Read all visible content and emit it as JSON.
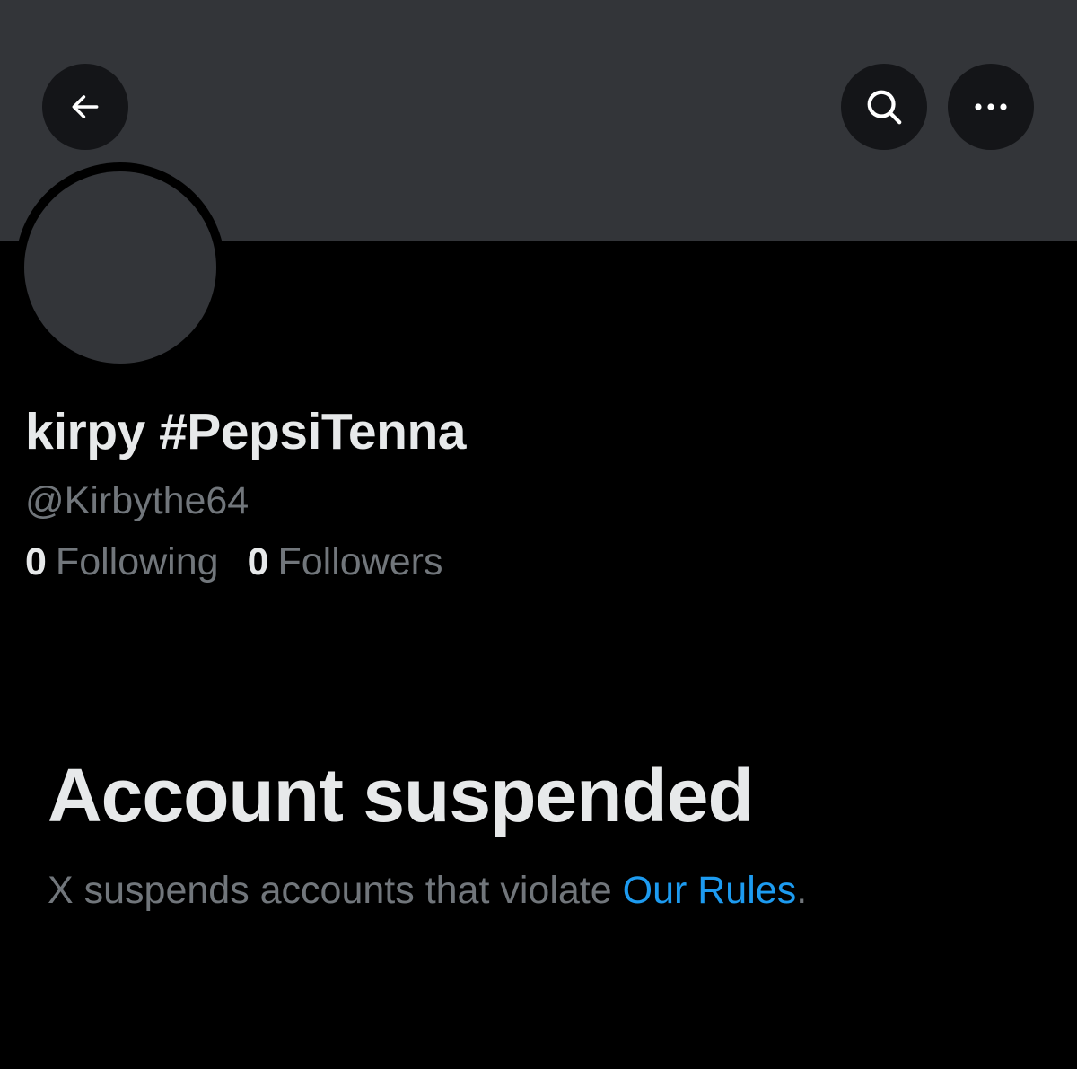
{
  "header": {
    "back_icon": "arrow-left-icon",
    "search_icon": "search-icon",
    "more_icon": "more-horizontal-icon"
  },
  "profile": {
    "display_name": "kirpy #PepsiTenna",
    "handle": "@Kirbythe64",
    "following_count": "0",
    "following_label": "Following",
    "followers_count": "0",
    "followers_label": "Followers"
  },
  "suspension": {
    "title": "Account suspended",
    "message_prefix": "X suspends accounts that violate ",
    "rules_link": "Our Rules",
    "message_suffix": "."
  },
  "colors": {
    "background": "#000000",
    "banner": "#333539",
    "button_bg": "#141518",
    "primary_text": "#e7e9ea",
    "secondary_text": "#71767b",
    "link": "#1d9bf0"
  }
}
